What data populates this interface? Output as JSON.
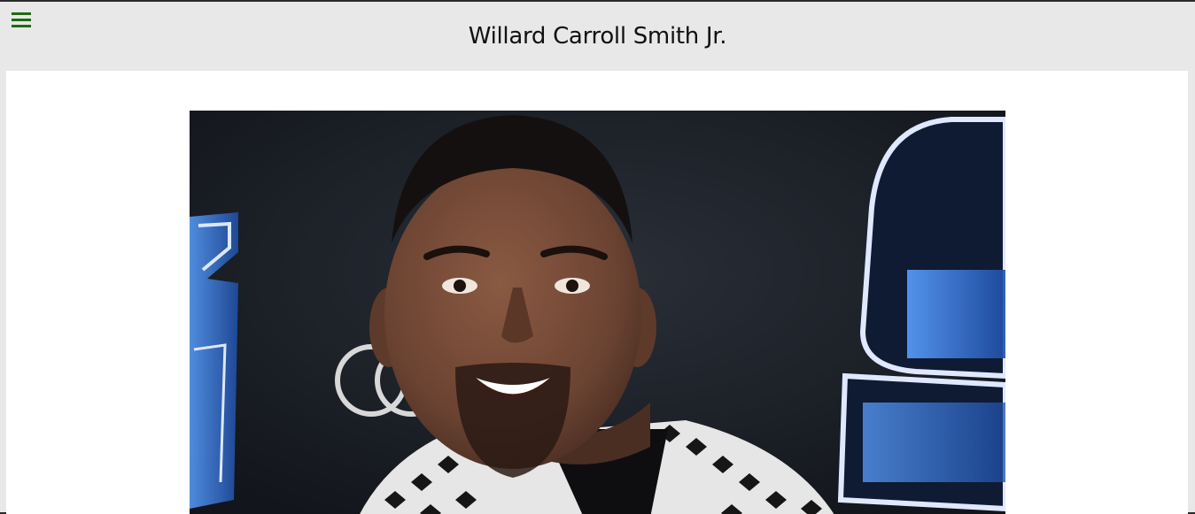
{
  "header": {
    "title": "Willard Carroll Smith Jr.",
    "menu_icon": "hamburger-menu-icon",
    "menu_icon_color": "#1e6b12"
  },
  "main": {
    "image_subject": "portrait photo of a smiling man"
  },
  "colors": {
    "background": "#e8e8e8",
    "content": "#ffffff",
    "photo_backdrop": "#1a1d24",
    "accent_blue": "#2b6fd6"
  }
}
